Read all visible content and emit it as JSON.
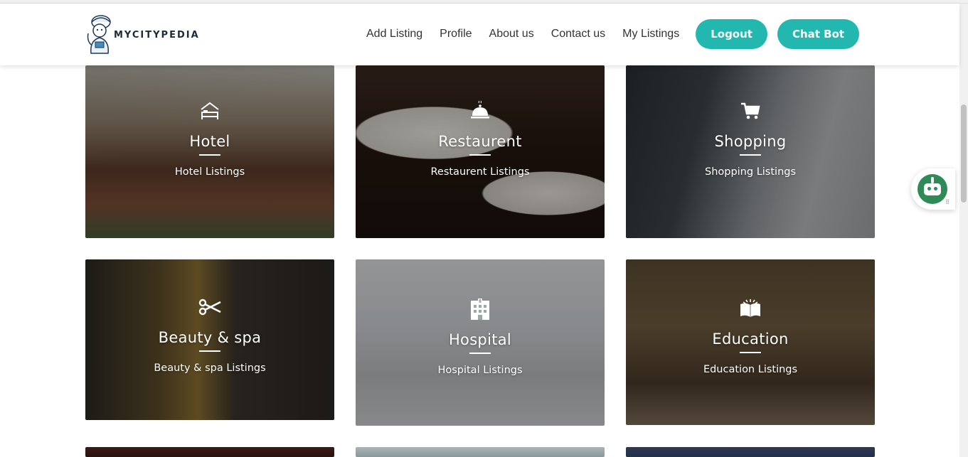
{
  "brand": {
    "name": "MYCITYPEDIA"
  },
  "nav": {
    "items": [
      {
        "label": "Add Listing"
      },
      {
        "label": "Profile"
      },
      {
        "label": "About us"
      },
      {
        "label": "Contact us"
      },
      {
        "label": "My Listings"
      }
    ],
    "logout_label": "Logout",
    "chatbot_label": "Chat Bot"
  },
  "colors": {
    "accent": "#22b8b0",
    "chatbot_icon": "#2e8b57"
  },
  "categories": [
    {
      "icon": "bed-icon",
      "title": "Hotel",
      "subtitle": "Hotel Listings"
    },
    {
      "icon": "food-cloche-icon",
      "title": "Restaurent",
      "subtitle": "Restaurent Listings"
    },
    {
      "icon": "shopping-cart-icon",
      "title": "Shopping",
      "subtitle": "Shopping Listings"
    },
    {
      "icon": "scissors-icon",
      "title": "Beauty & spa",
      "subtitle": "Beauty & spa Listings"
    },
    {
      "icon": "hospital-icon",
      "title": "Hospital",
      "subtitle": "Hospital Listings"
    },
    {
      "icon": "open-book-icon",
      "title": "Education",
      "subtitle": "Education Listings"
    }
  ]
}
